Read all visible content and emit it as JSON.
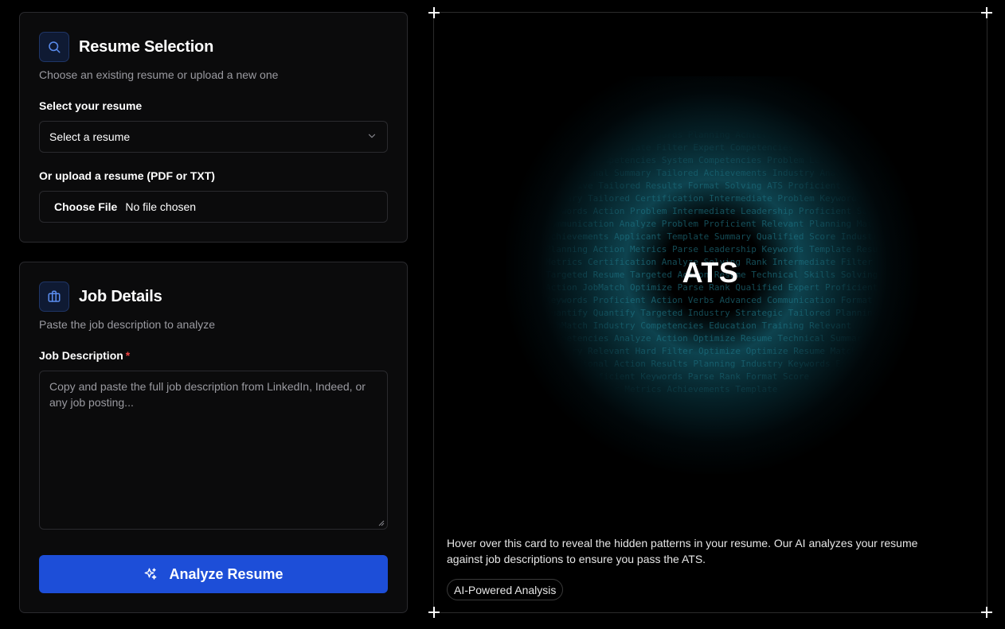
{
  "resume_card": {
    "title": "Resume Selection",
    "subtitle": "Choose an existing resume or upload a new one",
    "select_label": "Select your resume",
    "select_value": "Select a resume",
    "upload_label": "Or upload a resume (PDF or TXT)",
    "file_button": "Choose File",
    "file_status": "No file chosen",
    "icon": "search-icon"
  },
  "job_card": {
    "title": "Job Details",
    "subtitle": "Paste the job description to analyze",
    "description_label": "Job Description",
    "required_marker": "*",
    "description_placeholder": "Copy and paste the full job description from LinkedIn, Indeed, or any job posting...",
    "icon": "briefcase-icon"
  },
  "analyze_button": {
    "label": "Analyze Resume",
    "icon": "sparkles-icon",
    "color": "#1d4ed8"
  },
  "ats_card": {
    "title": "ATS",
    "description": "Hover over this card to reveal the hidden patterns in your resume. Our AI analyzes your resume against job descriptions to ensure you pass the ATS.",
    "badge": "AI-Powered Analysis",
    "glow_color": "#104e5c",
    "word_rows": [
      "Fluent Proficient Keywords Planning Achievements Expert Parse Results",
      "Summary Intermediate Filter Expert Competencies Objective Keywords",
      "Industry Competencies System Competencies Problem Leadership Format",
      "Professional Summary Tailored Achievements Industry Analyze Match",
      "Objective Tailored Results Format Solving ATS Proficient Expert",
      "Summary Tailored Certification Intermediate Problem Keywords",
      "Keywords Action Problem Intermediate Leadership Proficient Score",
      "Communication Analyze Problem Proficient Relevant Planning Match",
      "Achievements Applicant Template Summary Qualified Score Industry",
      "Planning Action Metrics Parse Leadership Keywords Template Results",
      "Metrics Certification Analyze Solving Rank Intermediate Filter",
      "Targeted Resume Targeted Action Resume Technical Skills Solving",
      "Action JobMatch Optimize Parse Rank Qualified Expert Proficient",
      "Keywords Proficient Action Verbs Advanced Communication Format",
      "Quantify Quantify Targeted Industry Strategic Tailored Planning",
      "JobMatch Industry Competencies Education Training Relevant",
      "Competencies Analyze Action Optimize Resume Technical Summary",
      "Summary Relevant Hard Filter Optimize Optimize Resume Match",
      "Professional Action Results Planning Industry Keywords Expert",
      "Fluent Proficient Keywords Parse Rank Format Score",
      "Summary Filter Metrics Achievements Template"
    ]
  }
}
